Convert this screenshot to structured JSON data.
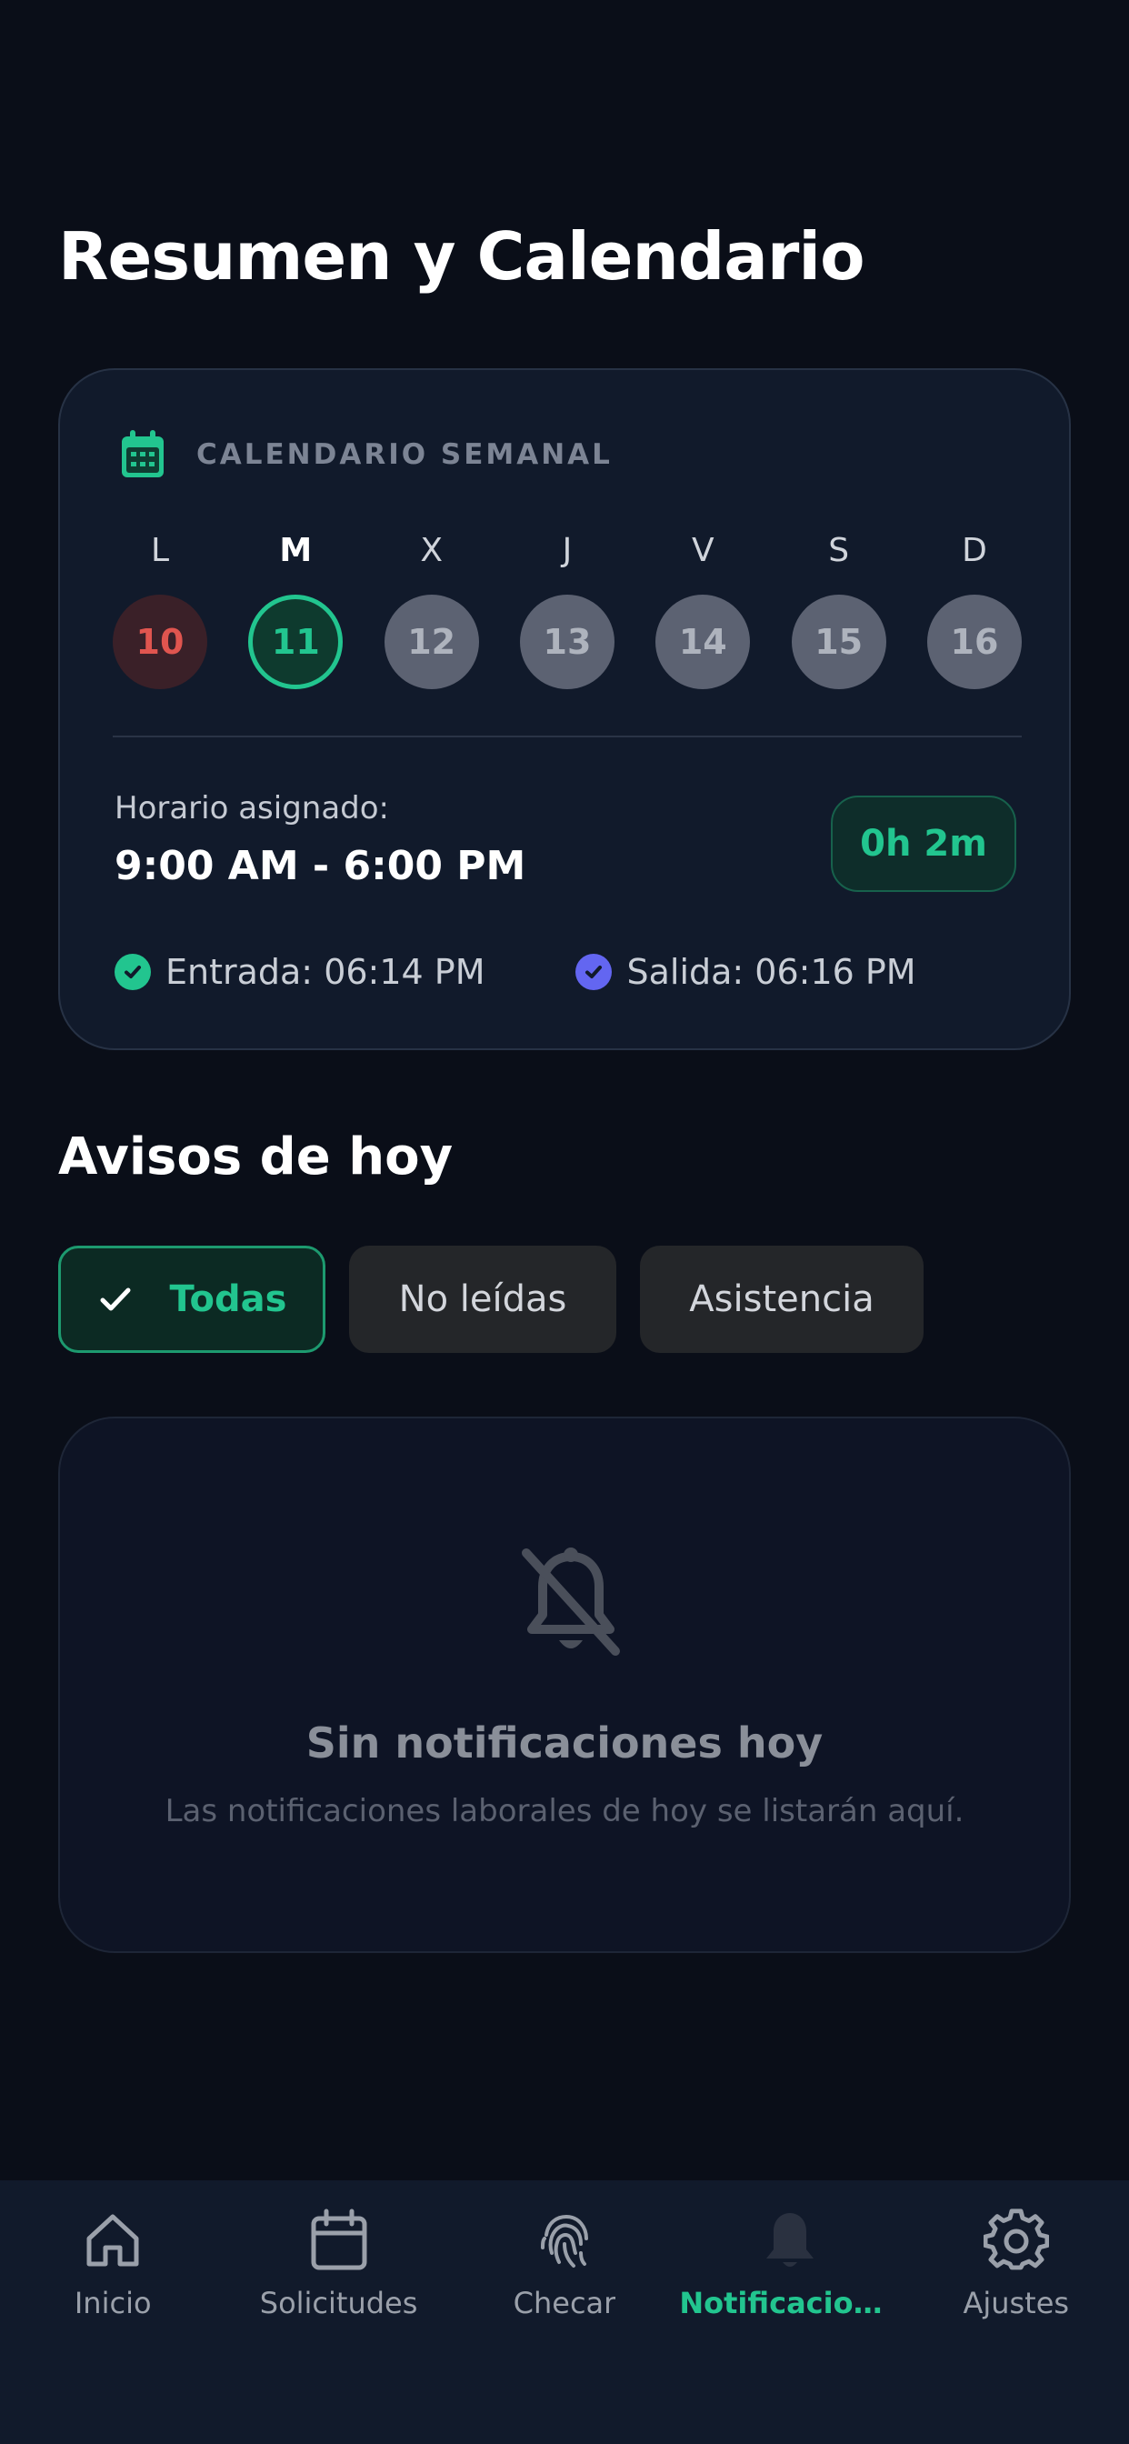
{
  "page": {
    "title": "Resumen y Calendario"
  },
  "calendar": {
    "header": "CALENDARIO SEMANAL",
    "days": [
      {
        "letter": "L",
        "num": "10",
        "state": "past"
      },
      {
        "letter": "M",
        "num": "11",
        "state": "today"
      },
      {
        "letter": "X",
        "num": "12",
        "state": "future"
      },
      {
        "letter": "J",
        "num": "13",
        "state": "future"
      },
      {
        "letter": "V",
        "num": "14",
        "state": "future"
      },
      {
        "letter": "S",
        "num": "15",
        "state": "future"
      },
      {
        "letter": "D",
        "num": "16",
        "state": "future"
      }
    ],
    "schedule_label": "Horario asignado:",
    "schedule_time": "9:00 AM - 6:00 PM",
    "duration": "0h 2m",
    "entry": "Entrada: 06:14 PM",
    "exit": "Salida: 06:16 PM"
  },
  "notices": {
    "title": "Avisos de hoy",
    "filters": {
      "all": "Todas",
      "unread": "No leídas",
      "attendance": "Asistencia"
    },
    "empty_title": "Sin notificaciones hoy",
    "empty_subtitle": "Las notificaciones laborales de hoy se listarán aquí."
  },
  "nav": {
    "home": "Inicio",
    "requests": "Solicitudes",
    "check": "Checar",
    "notifications": "Notificacion...",
    "settings": "Ajustes"
  },
  "colors": {
    "background": "#0a0e18",
    "card": "#111a2b",
    "accent": "#22c58f",
    "past_day": "#e0554f",
    "exit_check": "#6366f1"
  },
  "icons": {
    "calendar_header": "calendar-icon",
    "empty_state": "bell-off-icon",
    "nav": [
      "home-icon",
      "calendar-icon",
      "fingerprint-icon",
      "bell-icon",
      "gear-icon"
    ]
  }
}
